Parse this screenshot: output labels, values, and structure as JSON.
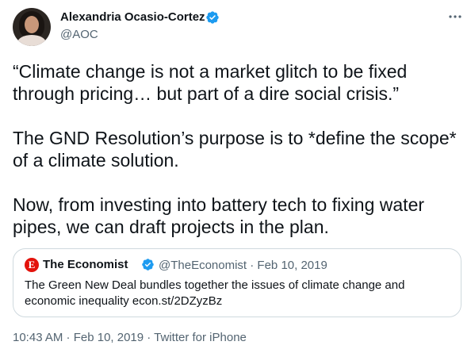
{
  "author": {
    "name": "Alexandria Ocasio-Cortez",
    "handle": "@AOC",
    "verified_icon": "verified-badge-icon"
  },
  "more_icon": "more-horizontal-icon",
  "tweet": {
    "paragraphs": [
      "“Climate change is not a market glitch to be fixed through pricing… but part of a dire social crisis.”",
      "The GND Resolution’s purpose is to *define the scope* of a climate solution.",
      "Now, from investing into battery tech to fixing water pipes, we can draft projects in the plan."
    ]
  },
  "quoted": {
    "logo_letter": "E",
    "name": "The Economist",
    "handle_date": "@TheEconomist · Feb 10, 2019",
    "text": "The Green New Deal bundles together the issues of climate change and economic inequality econ.st/2DZyzBz"
  },
  "footer": {
    "meta": "10:43 AM · Feb 10, 2019 · Twitter for iPhone"
  },
  "colors": {
    "verified_blue": "#1d9bf0",
    "economist_red": "#e3120b",
    "secondary_text": "#536471",
    "border": "#cfd9de"
  }
}
